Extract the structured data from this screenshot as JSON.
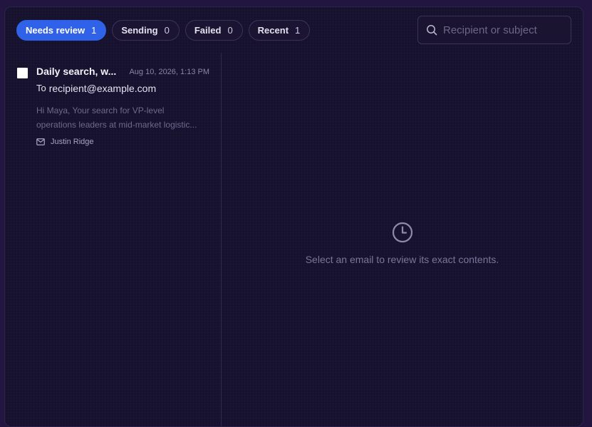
{
  "tabs": [
    {
      "label": "Needs review",
      "count": "1",
      "active": true
    },
    {
      "label": "Sending",
      "count": "0",
      "active": false
    },
    {
      "label": "Failed",
      "count": "0",
      "active": false
    },
    {
      "label": "Recent",
      "count": "1",
      "active": false
    }
  ],
  "search": {
    "placeholder": "Recipient or subject",
    "value": "",
    "icon": "search-icon"
  },
  "emails": [
    {
      "subject": "Daily search, w...",
      "date": "Aug 10, 2026, 1:13 PM",
      "to_label": "To",
      "to": "recipient@example.com",
      "preview_line1": "Hi Maya, Your search for VP-level",
      "preview_line2": "operations leaders at mid-market logistic...",
      "sender": "Justin Ridge",
      "sender_icon": "mail-icon",
      "selected": false
    }
  ],
  "detail": {
    "empty_message": "Select an email to review its exact contents.",
    "icon": "clock-icon"
  },
  "colors": {
    "accent": "#2f62e8",
    "background": "#16112e",
    "outer": "#221640"
  }
}
